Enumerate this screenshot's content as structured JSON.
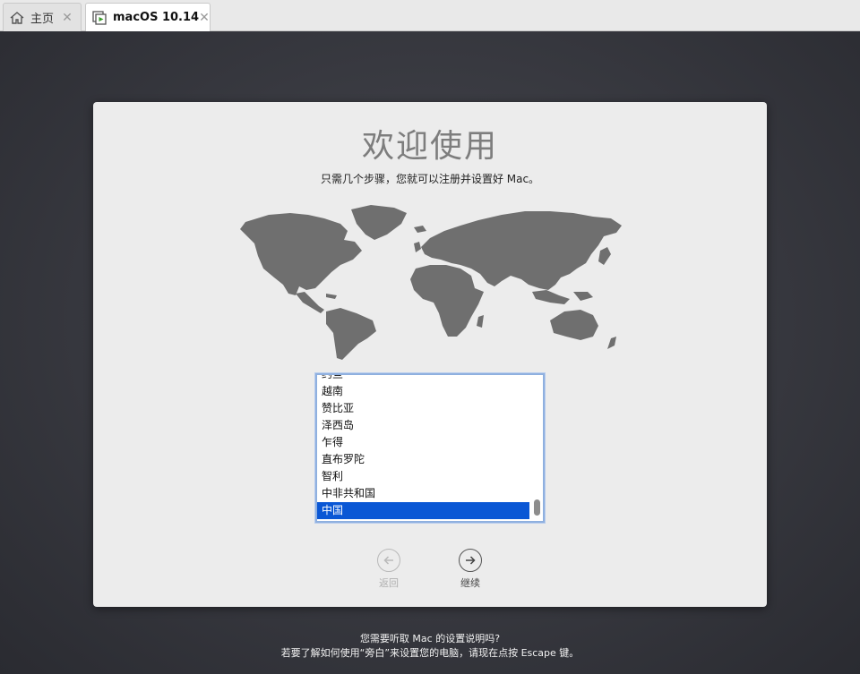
{
  "tabs": [
    {
      "label": "主页",
      "icon": "home-icon"
    },
    {
      "label": "macOS 10.14",
      "icon": "vm-icon"
    }
  ],
  "setup": {
    "title": "欢迎使用",
    "subtitle": "只需几个步骤，您就可以注册并设置好 Mac。",
    "countries": [
      "约旦",
      "越南",
      "赞比亚",
      "泽西岛",
      "乍得",
      "直布罗陀",
      "智利",
      "中非共和国",
      "中国"
    ],
    "selected_country": "中国",
    "back_label": "返回",
    "continue_label": "继续"
  },
  "footer": {
    "line1": "您需要听取 Mac 的设置说明吗?",
    "line2": "若要了解如何使用“旁白”来设置您的电脑，请现在点按 Escape 键。"
  },
  "colors": {
    "selection": "#0a57d5",
    "map_land": "#6f6f6f",
    "panel": "#ececec",
    "background": "#2f3038"
  }
}
